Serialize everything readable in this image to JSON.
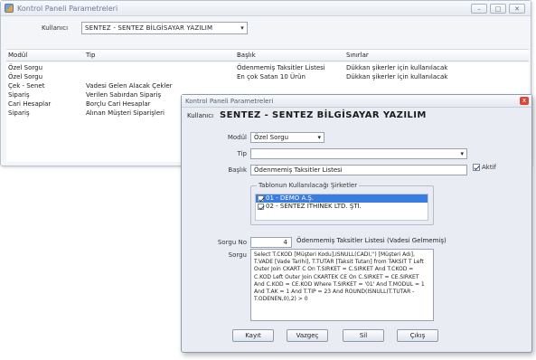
{
  "back_window": {
    "title": "Kontrol Paneli Parametreleri",
    "controls": {
      "minimize": "–",
      "maximize": "□",
      "close": "✕"
    },
    "kullanici_label": "Kullanıcı",
    "kullanici_value": "SENTEZ - SENTEZ BİLGİSAYAR YAZILIM",
    "grid": {
      "headers": [
        "Modül",
        "Tip",
        "Başlık",
        "Sınırlar"
      ],
      "rows": [
        [
          "Özel Sorgu",
          "",
          "Ödenmemiş Taksitler Listesi",
          "Dükkan şikerler için kullanılacak"
        ],
        [
          "Özel Sorgu",
          "",
          "En çok Satan 10 Ürün",
          "Dükkan şikerler için kullanılacak"
        ],
        [
          "Çek - Senet",
          "Vadesi Gelen Alacak Çekler",
          "",
          ""
        ],
        [
          "Sipariş",
          "Verilen Sabırdan Sipariş",
          "",
          ""
        ],
        [
          "Cari Hesaplar",
          "Borçlu Cari Hesaplar",
          "",
          ""
        ],
        [
          "Sipariş",
          "Alınan Müşteri Siparişleri",
          "",
          ""
        ]
      ]
    }
  },
  "dialog": {
    "title": "Kontrol Paneli Parametreleri",
    "kullanici_label": "Kullanıcı",
    "kullanici_value": "SENTEZ - SENTEZ BİLGİSAYAR YAZILIM",
    "modul_label": "Modül",
    "modul_value": "Özel Sorgu",
    "tip_label": "Tip",
    "tip_value": "",
    "baslik_label": "Başlık",
    "baslik_value": "Ödenmemiş Taksitler Listesi",
    "aktif_label": "Aktif",
    "aktif_checked": true,
    "group_title": "Tablonun Kullanılacağı Şirketler",
    "companies": [
      {
        "label": "01 - DEMO A.Ş.",
        "checked": true,
        "selected": true
      },
      {
        "label": "02 - SENTEZ İTHİNEK LTD. ŞTİ.",
        "checked": true,
        "selected": false
      }
    ],
    "sorgu_no_label": "Sorgu No",
    "sorgu_no_value": "4",
    "sorgu_desc": "Ödenmemiş Taksitler Listesi (Vadesi Gelmemiş)",
    "sorgu_label": "Sorgu",
    "sql": "Select T.CKOD [Müşteri Kodu],ISNULL(CADI,'') [Müşteri Adı], T.VADE [Vade Tarihi], T.TUTAR [Taksit Tutarı] from TAKSIT T Left Outer Join CKART C On T.SIRKET = C.SIRKET And T.CKOD = C.KOD Left Outer Join CKARTEK CE On C.SIRKET = CE.SIRKET And C.KOD = CE.KOD Where T.SIRKET = '01' And T.MODUL = 1 And T.AK = 1 And T.TIP = 23 And ROUND(ISNULL(T.TUTAR - T.ODENEN,0),2) > 0",
    "buttons": {
      "kayit": "Kayıt",
      "vazgec": "Vazgeç",
      "sil": "Sil",
      "cikis": "Çıkış"
    },
    "close": "x"
  }
}
